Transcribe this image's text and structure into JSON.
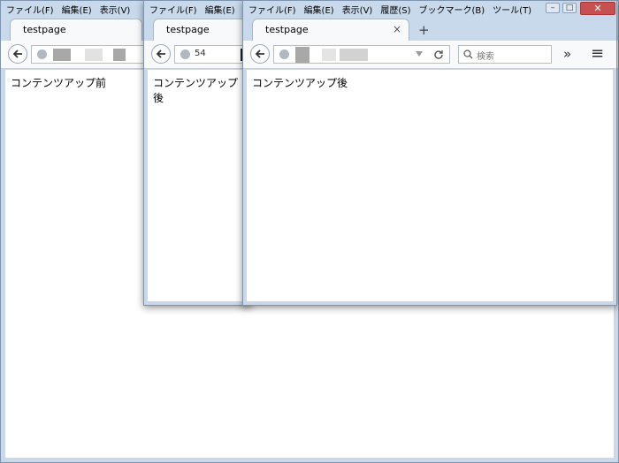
{
  "menu": [
    "ファイル(F)",
    "編集(E)",
    "表示(V)",
    "履歴(S)",
    "ブックマーク(B)",
    "ツール(T)"
  ],
  "window1": {
    "menu": [
      "ファイル(F)",
      "編集(E)",
      "表示(V)"
    ],
    "tab_title": "testpage",
    "content_text": "コンテンツアップ前"
  },
  "window2": {
    "menu": [
      "ファイル(F)",
      "編集(E)"
    ],
    "tab_title": "testpage",
    "url_text": "54",
    "content_text": "コンテンツアップ後"
  },
  "window3": {
    "tab_title": "testpage",
    "tab_close": "×",
    "new_tab": "+",
    "search_placeholder": "検索",
    "overflow": "»",
    "hamburger": "≡",
    "content_text": "コンテンツアップ後",
    "window_controls": {
      "minimize": "–",
      "maximize": "□",
      "close": "✕"
    }
  }
}
